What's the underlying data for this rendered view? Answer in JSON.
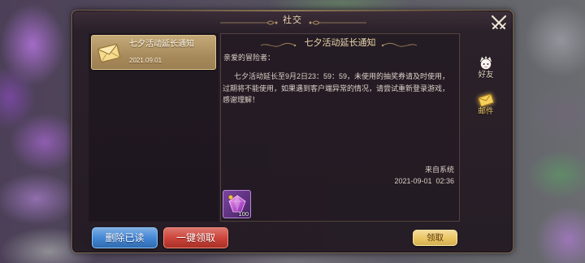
{
  "dialog": {
    "title": "社交",
    "close_icon": "close-icon"
  },
  "mail_list": [
    {
      "title": "七夕活动延长通知",
      "date": "2021.09.01",
      "icon": "envelope-icon",
      "selected": true
    }
  ],
  "mail": {
    "title": "七夕活动延长通知",
    "greeting": "亲爱的冒险者：",
    "body_lines": [
      "七夕活动延长至9月2日23：59：59，未使用的抽奖券请及时使用，",
      "过期将不能使用，如果遇到客户端异常的情况，请尝试重新登录游戏，",
      "感谢理解！"
    ],
    "sender": "来自系统",
    "time": "2021-09-01  02:36",
    "attachments": [
      {
        "icon": "purple-gem-icon",
        "count": "100"
      }
    ]
  },
  "side_tabs": [
    {
      "label": "好友",
      "icon": "friend-icon",
      "active": false
    },
    {
      "label": "邮件",
      "icon": "mail-icon",
      "active": true
    }
  ],
  "buttons": {
    "delete_read": "删除已读",
    "claim_all": "一键领取",
    "claim": "领取"
  },
  "theme": {
    "delete_button": "#3b82d4",
    "claim_all_button": "#cc3b30",
    "claim_button": "#ecc45c",
    "active_tab": "#f2cf6a",
    "title_color": "#e9d6ae"
  }
}
